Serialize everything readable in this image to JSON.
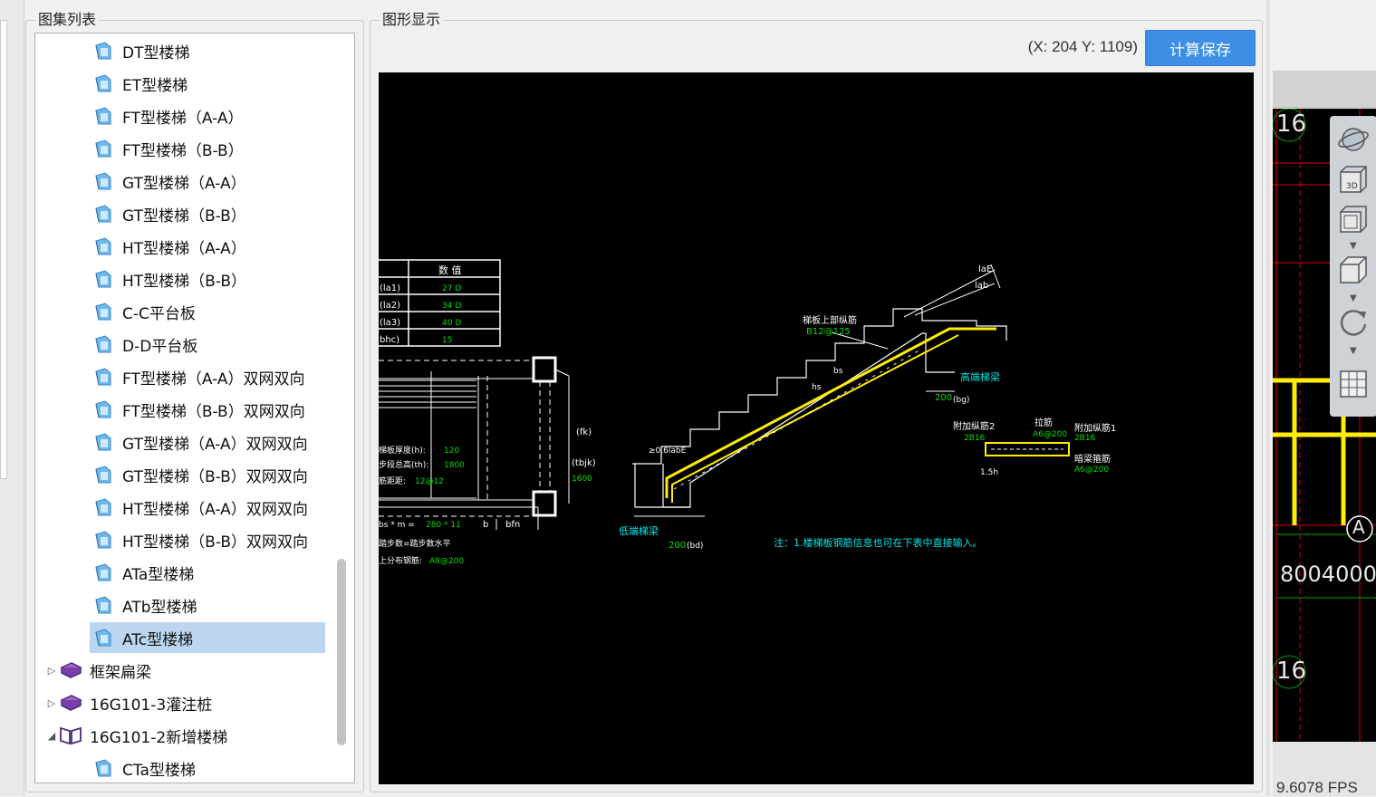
{
  "panels": {
    "atlas_title": "图集列表",
    "graphic_title": "图形显示"
  },
  "tree": {
    "children": [
      {
        "label": "DT型楼梯"
      },
      {
        "label": "ET型楼梯"
      },
      {
        "label": "FT型楼梯（A-A）"
      },
      {
        "label": "FT型楼梯（B-B）"
      },
      {
        "label": "GT型楼梯（A-A）"
      },
      {
        "label": "GT型楼梯（B-B）"
      },
      {
        "label": "HT型楼梯（A-A）"
      },
      {
        "label": "HT型楼梯（B-B）"
      },
      {
        "label": "C-C平台板"
      },
      {
        "label": "D-D平台板"
      },
      {
        "label": "FT型楼梯（A-A）双网双向"
      },
      {
        "label": "FT型楼梯（B-B）双网双向"
      },
      {
        "label": "GT型楼梯（A-A）双网双向"
      },
      {
        "label": "GT型楼梯（B-B）双网双向"
      },
      {
        "label": "HT型楼梯（A-A）双网双向"
      },
      {
        "label": "HT型楼梯（B-B）双网双向"
      },
      {
        "label": "ATa型楼梯"
      },
      {
        "label": "ATb型楼梯"
      },
      {
        "label": "ATc型楼梯",
        "selected": true
      }
    ],
    "groups": [
      {
        "label": "框架扁梁",
        "expanded": false
      },
      {
        "label": "16G101-3灌注桩",
        "expanded": false
      },
      {
        "label": "16G101-2新增楼梯",
        "expanded": true
      }
    ],
    "last_child": "CTa型楼梯"
  },
  "display": {
    "coords": "(X: 204 Y: 1109)",
    "calc_save_label": "计算保存"
  },
  "drawing": {
    "table_header": "数 值",
    "table_rows": [
      {
        "key": "(la1)",
        "val": "27 D"
      },
      {
        "key": "(la2)",
        "val": "34 D"
      },
      {
        "key": "(la3)",
        "val": "40 D"
      },
      {
        "key": "bhc)",
        "val": "15"
      }
    ],
    "plan_labels": {
      "thickness": "梯板厚度(h):",
      "thickness_val": "120",
      "total_height": "步段总高(th):",
      "total_height_val": "1800",
      "rebar_dist": "筋距距:",
      "rebar_dist_val": "12@12",
      "fk": "(fk)",
      "tbjk": "(tbjk)",
      "tbjk_val": "1600",
      "bs": "bs * m =",
      "bs_val": "280 * 11",
      "b": "b",
      "bfn": "bfn",
      "steps": "踏步数=踏步数水平",
      "dist_rebar": "上分布钢筋:",
      "dist_rebar_val": "A8@200"
    },
    "section_labels": {
      "top_rebar": "梯板上部纵筋",
      "top_rebar_val": "B12@125",
      "lae": "laE",
      "lab": "lab",
      "high_beam": "高端梯梁",
      "low_beam": "低端梯梁",
      "bg": "200",
      "bg_unit": "(bg)",
      "bd": "200",
      "bd_unit": "(bd)",
      "la_label": "≥0.6labE",
      "hs": "hs",
      "bs": "bs",
      "note": "注：1.楼梯板钢筋信息也可在下表中直接输入。",
      "extra1": "附加纵筋2",
      "extra1_val": "2B16",
      "tie": "拉筋",
      "tie_val": "A6@200",
      "extra2": "附加纵筋1",
      "extra2_val": "2B16",
      "stirrup": "暗梁箍筋",
      "stirrup_val": "A6@200",
      "one_five_h": "1.5h"
    }
  },
  "right_view": {
    "label_top": "16",
    "label_bottom": "16",
    "label_a": "A",
    "dim": "8004000",
    "fps": "9.6078 FPS",
    "toolbar": [
      "orbit-icon",
      "view-3d-icon",
      "view-top-icon",
      "view-iso-icon",
      "rotate-icon",
      "grid-settings-icon"
    ]
  },
  "colors": {
    "accent_button": "#3c8ee6",
    "selection": "#bcd6f0",
    "cad_yellow": "#ffee00",
    "cad_green": "#00e000",
    "cad_cyan": "#00e5e5",
    "cad_red": "#e00000"
  }
}
